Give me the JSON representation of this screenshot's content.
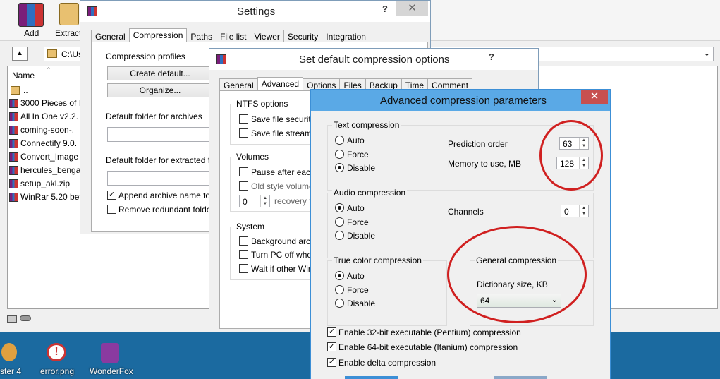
{
  "colors": {
    "desktop": "#1b6aa0",
    "close_red": "#c75050",
    "annotation_red": "#d02020"
  },
  "winrar": {
    "toolbar": {
      "add_label": "Add",
      "extract_label": "Extract"
    },
    "path": "C:\\Us",
    "list_header": "Name",
    "parent_dir": "..",
    "files": [
      "3000 Pieces of I",
      "All In One v2.2.",
      "coming-soon-.",
      "Connectify 9.0.",
      "Convert_Image",
      "hercules_benga",
      "setup_akl.zip",
      "WinRar 5.20 bet"
    ]
  },
  "desktop_icons": [
    {
      "label": "ster 4",
      "icon": "palette-icon"
    },
    {
      "label": "error.png",
      "icon": "error-icon"
    },
    {
      "label": "WonderFox",
      "icon": "wonderfox-icon"
    }
  ],
  "settings": {
    "title": "Settings",
    "help": "?",
    "close": "✕",
    "tabs": [
      "General",
      "Compression",
      "Paths",
      "File list",
      "Viewer",
      "Security",
      "Integration"
    ],
    "compression_profiles_label": "Compression profiles",
    "create_default_button": "Create default...",
    "organize_button": "Organize...",
    "default_folder_archives_label": "Default folder for archives",
    "default_folder_extracted_label": "Default folder for extracted fil",
    "append_archive_name": "Append archive name to pa",
    "remove_redundant": "Remove redundant folders"
  },
  "default_options": {
    "title": "Set default compression options",
    "help": "?",
    "tabs": [
      "General",
      "Advanced",
      "Options",
      "Files",
      "Backup",
      "Time",
      "Comment"
    ],
    "ntfs_label": "NTFS options",
    "save_file_security": "Save file security",
    "save_file_streams": "Save file streams",
    "volumes_label": "Volumes",
    "pause_after_each": "Pause after each",
    "old_style_volume": "Old style volume n",
    "recovery_value": "0",
    "recovery_label": "recovery v",
    "system_label": "System",
    "background_archive": "Background archiv",
    "turn_pc_off": "Turn PC off when",
    "wait_if_other": "Wait if other WinR"
  },
  "advanced": {
    "title": "Advanced compression parameters",
    "close": "✕",
    "text_compression": {
      "label": "Text compression",
      "auto": "Auto",
      "force": "Force",
      "disable": "Disable",
      "selected": "Disable",
      "prediction_order_label": "Prediction order",
      "prediction_order_value": "63",
      "memory_label": "Memory to use, MB",
      "memory_value": "128"
    },
    "audio_compression": {
      "label": "Audio compression",
      "auto": "Auto",
      "force": "Force",
      "disable": "Disable",
      "selected": "Auto",
      "channels_label": "Channels",
      "channels_value": "0"
    },
    "true_color_compression": {
      "label": "True color compression",
      "auto": "Auto",
      "force": "Force",
      "disable": "Disable",
      "selected": "Auto"
    },
    "general_compression": {
      "label": "General compression",
      "dictionary_label": "Dictionary size, KB",
      "dictionary_value": "64"
    },
    "enable_32bit": "Enable 32-bit executable (Pentium) compression",
    "enable_64bit": "Enable 64-bit executable (Itanium) compression",
    "enable_delta": "Enable delta compression"
  }
}
